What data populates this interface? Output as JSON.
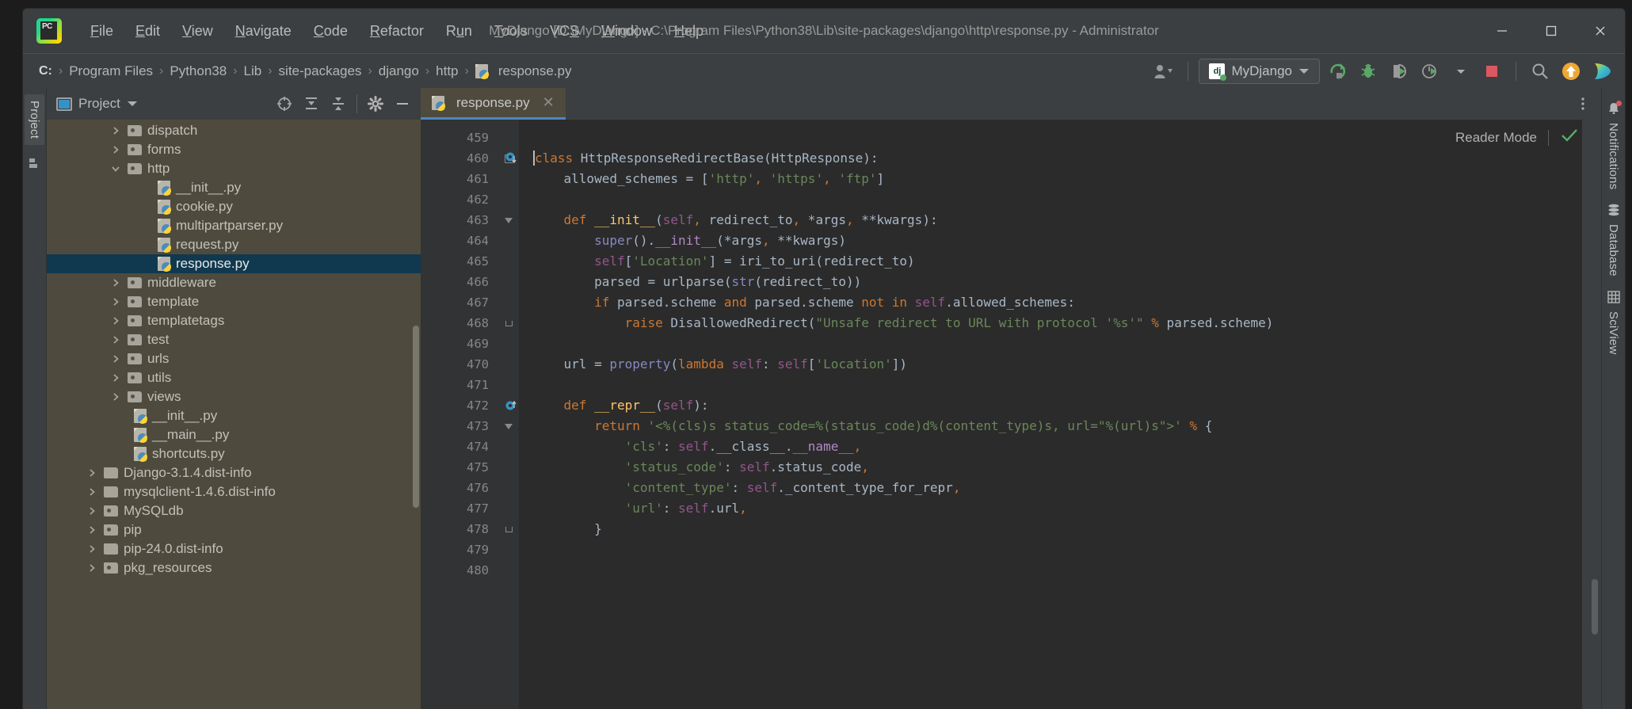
{
  "window": {
    "title": "MyDjango [D:\\MyDjango] - C:\\Program Files\\Python38\\Lib\\site-packages\\django\\http\\response.py - Administrator",
    "app_logo": "pycharm-logo",
    "controls": {
      "minimize": "—",
      "maximize": "□",
      "close": "✕"
    }
  },
  "menubar": {
    "items": [
      {
        "label": "File",
        "mnemonic": "F"
      },
      {
        "label": "Edit",
        "mnemonic": "E"
      },
      {
        "label": "View",
        "mnemonic": "V"
      },
      {
        "label": "Navigate",
        "mnemonic": "N"
      },
      {
        "label": "Code",
        "mnemonic": "C"
      },
      {
        "label": "Refactor",
        "mnemonic": "R"
      },
      {
        "label": "Run",
        "mnemonic": "u"
      },
      {
        "label": "Tools",
        "mnemonic": "T"
      },
      {
        "label": "VCS",
        "mnemonic": "S"
      },
      {
        "label": "Window",
        "mnemonic": "W"
      },
      {
        "label": "Help",
        "mnemonic": "H"
      }
    ]
  },
  "breadcrumb": {
    "separator": "›",
    "items": [
      "C:",
      "Program Files",
      "Python38",
      "Lib",
      "site-packages",
      "django",
      "http"
    ],
    "file": "response.py"
  },
  "toolbar": {
    "user_icon": "user-account-icon",
    "run_config": {
      "label": "MyDjango",
      "icon": "django-icon",
      "chevron": "▼"
    },
    "buttons": [
      {
        "name": "run-button",
        "icon": "run-icon",
        "color": "#59a869"
      },
      {
        "name": "debug-button",
        "icon": "debug-bug-icon",
        "color": "#59a869"
      },
      {
        "name": "run-coverage-button",
        "icon": "coverage-icon",
        "color": "#59a869"
      },
      {
        "name": "profile-button",
        "icon": "profiler-icon",
        "color": "#59a869"
      },
      {
        "name": "stop-button",
        "icon": "stop-icon",
        "color": "#db5860"
      },
      {
        "name": "search-everywhere-button",
        "icon": "search-icon",
        "color": "#a0a0a0"
      },
      {
        "name": "update-button",
        "icon": "arrow-up-circle-icon",
        "color": "#f0a732"
      },
      {
        "name": "plugin-button",
        "icon": "gradient-arrow-icon",
        "color": "#3ec2c2"
      }
    ]
  },
  "left_strip": {
    "tabs": [
      {
        "label": "Project",
        "icon": "project-icon"
      }
    ],
    "structure_icon": "structure-icon"
  },
  "project_panel": {
    "title": "Project",
    "chevron": "▼",
    "window_icon": "project-window-icon",
    "tools": [
      {
        "name": "select-opened-file-button",
        "icon": "target-icon"
      },
      {
        "name": "expand-all-button",
        "icon": "expand-all-icon"
      },
      {
        "name": "collapse-all-button",
        "icon": "collapse-all-icon"
      },
      {
        "name": "settings-button",
        "icon": "gear-icon"
      },
      {
        "name": "hide-button",
        "icon": "minus-icon"
      }
    ],
    "tree": [
      {
        "label": "dispatch",
        "type": "folder",
        "indent": 2,
        "arrow": "collapsed",
        "selected": false
      },
      {
        "label": "forms",
        "type": "folder",
        "indent": 2,
        "arrow": "collapsed",
        "selected": false
      },
      {
        "label": "http",
        "type": "folder",
        "indent": 2,
        "arrow": "expanded",
        "selected": false
      },
      {
        "label": "__init__.py",
        "type": "python",
        "indent": 3,
        "arrow": "none",
        "selected": false
      },
      {
        "label": "cookie.py",
        "type": "python",
        "indent": 3,
        "arrow": "none",
        "selected": false
      },
      {
        "label": "multipartparser.py",
        "type": "python",
        "indent": 3,
        "arrow": "none",
        "selected": false
      },
      {
        "label": "request.py",
        "type": "python",
        "indent": 3,
        "arrow": "none",
        "selected": false
      },
      {
        "label": "response.py",
        "type": "python",
        "indent": 3,
        "arrow": "none",
        "selected": true
      },
      {
        "label": "middleware",
        "type": "folder",
        "indent": 2,
        "arrow": "collapsed",
        "selected": false
      },
      {
        "label": "template",
        "type": "folder",
        "indent": 2,
        "arrow": "collapsed",
        "selected": false
      },
      {
        "label": "templatetags",
        "type": "folder",
        "indent": 2,
        "arrow": "collapsed",
        "selected": false
      },
      {
        "label": "test",
        "type": "folder",
        "indent": 2,
        "arrow": "collapsed",
        "selected": false
      },
      {
        "label": "urls",
        "type": "folder",
        "indent": 2,
        "arrow": "collapsed",
        "selected": false
      },
      {
        "label": "utils",
        "type": "folder",
        "indent": 2,
        "arrow": "collapsed",
        "selected": false
      },
      {
        "label": "views",
        "type": "folder",
        "indent": 2,
        "arrow": "collapsed",
        "selected": false
      },
      {
        "label": "__init__.py",
        "type": "python",
        "indent": 2,
        "arrow": "none",
        "selected": false
      },
      {
        "label": "__main__.py",
        "type": "python",
        "indent": 2,
        "arrow": "none",
        "selected": false
      },
      {
        "label": "shortcuts.py",
        "type": "python",
        "indent": 2,
        "arrow": "none",
        "selected": false
      },
      {
        "label": "Django-3.1.4.dist-info",
        "type": "folder-plain",
        "indent": 1,
        "arrow": "collapsed",
        "selected": false
      },
      {
        "label": "mysqlclient-1.4.6.dist-info",
        "type": "folder-plain",
        "indent": 1,
        "arrow": "collapsed",
        "selected": false
      },
      {
        "label": "MySQLdb",
        "type": "folder",
        "indent": 1,
        "arrow": "collapsed",
        "selected": false
      },
      {
        "label": "pip",
        "type": "folder",
        "indent": 1,
        "arrow": "collapsed",
        "selected": false
      },
      {
        "label": "pip-24.0.dist-info",
        "type": "folder-plain",
        "indent": 1,
        "arrow": "collapsed",
        "selected": false
      },
      {
        "label": "pkg_resources",
        "type": "folder",
        "indent": 1,
        "arrow": "collapsed",
        "selected": false
      }
    ]
  },
  "editor": {
    "tab": {
      "label": "response.py",
      "icon": "python-file-icon",
      "close": "✕"
    },
    "reader_mode": {
      "label": "Reader Mode",
      "check_icon": "checkmark-icon"
    },
    "more_icon": "more-vertical-icon",
    "first_line_number": 459,
    "lines": [
      {
        "n": 459,
        "fold": "",
        "gmark": "",
        "tokens": []
      },
      {
        "n": 460,
        "fold": "minus",
        "gmark": "override-down",
        "tokens": [
          {
            "t": "class ",
            "c": "kw"
          },
          {
            "t": "HttpResponseRedirectBase",
            "c": "txt"
          },
          {
            "t": "(",
            "c": "txt"
          },
          {
            "t": "HttpResponse",
            "c": "txt"
          },
          {
            "t": "):",
            "c": "txt"
          }
        ]
      },
      {
        "n": 461,
        "fold": "",
        "gmark": "",
        "tokens": [
          {
            "t": "    allowed_schemes = [",
            "c": "txt"
          },
          {
            "t": "'http'",
            "c": "str"
          },
          {
            "t": ",",
            "c": "kw"
          },
          {
            "t": " ",
            "c": "txt"
          },
          {
            "t": "'https'",
            "c": "str"
          },
          {
            "t": ",",
            "c": "kw"
          },
          {
            "t": " ",
            "c": "txt"
          },
          {
            "t": "'ftp'",
            "c": "str"
          },
          {
            "t": "]",
            "c": "txt"
          }
        ]
      },
      {
        "n": 462,
        "fold": "",
        "gmark": "",
        "tokens": []
      },
      {
        "n": 463,
        "fold": "tri",
        "gmark": "",
        "tokens": [
          {
            "t": "    ",
            "c": "txt"
          },
          {
            "t": "def ",
            "c": "kw"
          },
          {
            "t": "__init__",
            "c": "fn"
          },
          {
            "t": "(",
            "c": "txt"
          },
          {
            "t": "self",
            "c": "self"
          },
          {
            "t": ",",
            "c": "kw"
          },
          {
            "t": " redirect_to",
            "c": "txt"
          },
          {
            "t": ",",
            "c": "kw"
          },
          {
            "t": " *args",
            "c": "txt"
          },
          {
            "t": ",",
            "c": "kw"
          },
          {
            "t": " **kwargs",
            "c": "txt"
          },
          {
            "t": "):",
            "c": "txt"
          }
        ]
      },
      {
        "n": 464,
        "fold": "",
        "gmark": "",
        "tokens": [
          {
            "t": "        ",
            "c": "txt"
          },
          {
            "t": "super",
            "c": "bui"
          },
          {
            "t": "().",
            "c": "txt"
          },
          {
            "t": "__init__",
            "c": "dun"
          },
          {
            "t": "(*args",
            "c": "txt"
          },
          {
            "t": ",",
            "c": "kw"
          },
          {
            "t": " **kwargs)",
            "c": "txt"
          }
        ]
      },
      {
        "n": 465,
        "fold": "",
        "gmark": "",
        "tokens": [
          {
            "t": "        ",
            "c": "txt"
          },
          {
            "t": "self",
            "c": "self"
          },
          {
            "t": "[",
            "c": "txt"
          },
          {
            "t": "'Location'",
            "c": "str"
          },
          {
            "t": "] = iri_to_uri(redirect_to)",
            "c": "txt"
          }
        ]
      },
      {
        "n": 466,
        "fold": "",
        "gmark": "",
        "tokens": [
          {
            "t": "        parsed = urlparse(",
            "c": "txt"
          },
          {
            "t": "str",
            "c": "bui"
          },
          {
            "t": "(redirect_to))",
            "c": "txt"
          }
        ]
      },
      {
        "n": 467,
        "fold": "",
        "gmark": "",
        "tokens": [
          {
            "t": "        ",
            "c": "txt"
          },
          {
            "t": "if ",
            "c": "kw"
          },
          {
            "t": "parsed.scheme ",
            "c": "txt"
          },
          {
            "t": "and ",
            "c": "kw"
          },
          {
            "t": "parsed.scheme ",
            "c": "txt"
          },
          {
            "t": "not in ",
            "c": "kw"
          },
          {
            "t": "self",
            "c": "self"
          },
          {
            "t": ".allowed_schemes:",
            "c": "txt"
          }
        ]
      },
      {
        "n": 468,
        "fold": "end",
        "gmark": "",
        "tokens": [
          {
            "t": "            ",
            "c": "txt"
          },
          {
            "t": "raise ",
            "c": "kw"
          },
          {
            "t": "DisallowedRedirect(",
            "c": "txt"
          },
          {
            "t": "\"Unsafe redirect to URL with protocol '%s'\"",
            "c": "str"
          },
          {
            "t": " ",
            "c": "txt"
          },
          {
            "t": "%",
            "c": "kw"
          },
          {
            "t": " parsed.scheme)",
            "c": "txt"
          }
        ]
      },
      {
        "n": 469,
        "fold": "",
        "gmark": "",
        "tokens": []
      },
      {
        "n": 470,
        "fold": "",
        "gmark": "",
        "tokens": [
          {
            "t": "    url = ",
            "c": "txt"
          },
          {
            "t": "property",
            "c": "bui"
          },
          {
            "t": "(",
            "c": "txt"
          },
          {
            "t": "lambda ",
            "c": "kw"
          },
          {
            "t": "self",
            "c": "self"
          },
          {
            "t": ": ",
            "c": "txt"
          },
          {
            "t": "self",
            "c": "self"
          },
          {
            "t": "[",
            "c": "txt"
          },
          {
            "t": "'Location'",
            "c": "str"
          },
          {
            "t": "])",
            "c": "txt"
          }
        ]
      },
      {
        "n": 471,
        "fold": "",
        "gmark": "",
        "tokens": []
      },
      {
        "n": 472,
        "fold": "",
        "gmark": "override-up",
        "tokens": [
          {
            "t": "    ",
            "c": "txt"
          },
          {
            "t": "def ",
            "c": "kw"
          },
          {
            "t": "__repr__",
            "c": "fn"
          },
          {
            "t": "(",
            "c": "txt"
          },
          {
            "t": "self",
            "c": "self"
          },
          {
            "t": "):",
            "c": "txt"
          }
        ]
      },
      {
        "n": 473,
        "fold": "tri",
        "gmark": "",
        "tokens": [
          {
            "t": "        ",
            "c": "txt"
          },
          {
            "t": "return ",
            "c": "kw"
          },
          {
            "t": "'<%(cls)s status_code=%(status_code)d%(content_type)s, url=\"%(url)s\">'",
            "c": "str"
          },
          {
            "t": " ",
            "c": "txt"
          },
          {
            "t": "%",
            "c": "kw"
          },
          {
            "t": " {",
            "c": "txt"
          }
        ]
      },
      {
        "n": 474,
        "fold": "",
        "gmark": "",
        "tokens": [
          {
            "t": "            ",
            "c": "txt"
          },
          {
            "t": "'cls'",
            "c": "str"
          },
          {
            "t": ": ",
            "c": "txt"
          },
          {
            "t": "self",
            "c": "self"
          },
          {
            "t": ".__class__.",
            "c": "txt"
          },
          {
            "t": "__name__",
            "c": "dun"
          },
          {
            "t": ",",
            "c": "kw"
          }
        ]
      },
      {
        "n": 475,
        "fold": "",
        "gmark": "",
        "tokens": [
          {
            "t": "            ",
            "c": "txt"
          },
          {
            "t": "'status_code'",
            "c": "str"
          },
          {
            "t": ": ",
            "c": "txt"
          },
          {
            "t": "self",
            "c": "self"
          },
          {
            "t": ".status_code",
            "c": "txt"
          },
          {
            "t": ",",
            "c": "kw"
          }
        ]
      },
      {
        "n": 476,
        "fold": "",
        "gmark": "",
        "tokens": [
          {
            "t": "            ",
            "c": "txt"
          },
          {
            "t": "'content_type'",
            "c": "str"
          },
          {
            "t": ": ",
            "c": "txt"
          },
          {
            "t": "self",
            "c": "self"
          },
          {
            "t": "._content_type_for_repr",
            "c": "txt"
          },
          {
            "t": ",",
            "c": "kw"
          }
        ]
      },
      {
        "n": 477,
        "fold": "",
        "gmark": "",
        "tokens": [
          {
            "t": "            ",
            "c": "txt"
          },
          {
            "t": "'url'",
            "c": "str"
          },
          {
            "t": ": ",
            "c": "txt"
          },
          {
            "t": "self",
            "c": "self"
          },
          {
            "t": ".url",
            "c": "txt"
          },
          {
            "t": ",",
            "c": "kw"
          }
        ]
      },
      {
        "n": 478,
        "fold": "end",
        "gmark": "",
        "tokens": [
          {
            "t": "        }",
            "c": "txt"
          }
        ]
      },
      {
        "n": 479,
        "fold": "",
        "gmark": "",
        "tokens": []
      },
      {
        "n": 480,
        "fold": "",
        "gmark": "",
        "tokens": []
      }
    ]
  },
  "right_strip": {
    "tabs": [
      {
        "label": "Notifications",
        "icon": "bell-icon",
        "badge": true
      },
      {
        "label": "Database",
        "icon": "database-icon",
        "badge": false
      },
      {
        "label": "SciView",
        "icon": "grid-icon",
        "badge": false
      }
    ]
  },
  "colors": {
    "accent": "#4a88c7",
    "selection": "#10394f",
    "panel_bg": "#3c3f41",
    "tree_bg": "#4e4b3e",
    "editor_bg": "#2b2b2b",
    "gutter_bg": "#313335",
    "green": "#59a869",
    "red": "#db5860",
    "orange": "#f0a732"
  }
}
